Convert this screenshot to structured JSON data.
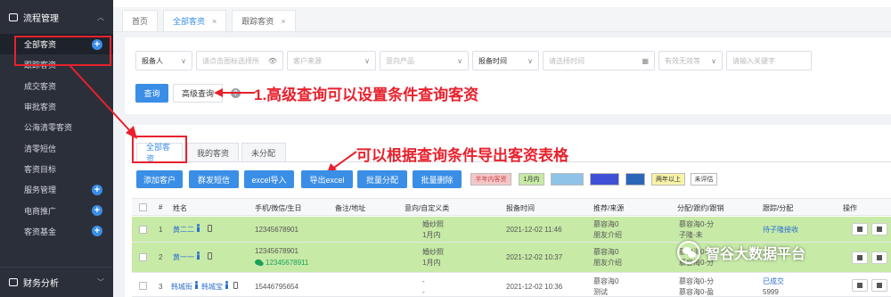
{
  "sidebar": {
    "group_title": "流程管理",
    "items": [
      {
        "label": "全部客资"
      },
      {
        "label": "跟踪客资"
      },
      {
        "label": "成交客资"
      },
      {
        "label": "审批客资"
      },
      {
        "label": "公海清零客资"
      },
      {
        "label": "清零短信"
      },
      {
        "label": "客资目标"
      },
      {
        "label": "服务管理"
      },
      {
        "label": "电商推广"
      },
      {
        "label": "客资基金"
      }
    ],
    "bottom_group": "财务分析"
  },
  "page_tabs": [
    {
      "label": "首页"
    },
    {
      "label": "全部客资",
      "close": "×"
    },
    {
      "label": "跟踪客资",
      "close": "×"
    }
  ],
  "filters": {
    "reporter": "报备人",
    "region_placeholder": "请点击图标选择所",
    "source_placeholder": "客户来源",
    "product_placeholder": "意向产品",
    "report_time": "报备时间",
    "date_placeholder": "请选择时间",
    "valid_placeholder": "有效无效等",
    "keyword_placeholder": "请输入关键字",
    "query_btn": "查询",
    "advanced_btn": "高级查询",
    "help": "?"
  },
  "annotations": {
    "a1": "1.高级查询可以设置条件查询客资",
    "a2": "可以根据查询条件导出客资表格"
  },
  "list_tabs": [
    {
      "label": "全部客资"
    },
    {
      "label": "我的客资"
    },
    {
      "label": "未分配"
    }
  ],
  "actions": [
    {
      "label": "添加客户"
    },
    {
      "label": "群发短信"
    },
    {
      "label": "excel导入"
    },
    {
      "label": "导出excel"
    },
    {
      "label": "批量分配"
    },
    {
      "label": "批量删除"
    }
  ],
  "legend": [
    {
      "label": "半年内客资",
      "color": "#f4c7c7",
      "text_color": "#c44"
    },
    {
      "label": "1月内",
      "color": "#c7eaa6",
      "text_color": "#333"
    },
    {
      "label": "",
      "color": "#8fc3e8",
      "text_color": "#333"
    },
    {
      "label": "",
      "color": "#3f4fd6",
      "text_color": "#fff"
    },
    {
      "label": "",
      "color": "#2b67b8",
      "text_color": "#fff"
    },
    {
      "label": "两年以上",
      "color": "#f8f3a8",
      "text_color": "#333"
    },
    {
      "label": "未评估",
      "color": "#ffffff",
      "text_color": "#333"
    }
  ],
  "table": {
    "headers": [
      "#",
      "姓名",
      "手机/微信/生日",
      "备注/地址",
      "意向/自定义类",
      "报备时间",
      "推荐/来源",
      "分配/跟约/跟销",
      "跟踪/分配",
      "操作"
    ],
    "rows": [
      {
        "index": "1",
        "name": "黄二二",
        "phone": "12345678901",
        "wechat": "",
        "note": "",
        "intent": "婚纱照",
        "intent2": "1月内",
        "time": "2021-12-02 11:46",
        "src1": "慕容海0",
        "src2": "朋友介绍",
        "assign1": "慕容海0-分",
        "assign2": "子隆-未",
        "track": "待子隆接收",
        "track2": ""
      },
      {
        "index": "2",
        "name": "黄一一",
        "phone": "12345678901",
        "wechat": "12345678911",
        "note": "",
        "intent": "婚纱照",
        "intent2": "1月内",
        "time": "2021-12-02 10:37",
        "src1": "慕容海0",
        "src2": "朋友介绍",
        "assign1": "慕容海0-分",
        "assign2": "慕容海0-分",
        "track": "",
        "track2": ""
      },
      {
        "index": "3",
        "name": "韩城街",
        "name2": "韩城宝",
        "phone": "15446795654",
        "wechat": "",
        "note": "",
        "intent": "-",
        "intent2": "-",
        "time": "2021-12-02 10:36",
        "src1": "慕容海0",
        "src2": "测试",
        "assign1": "慕容海0-分",
        "assign2": "慕容海0-盈",
        "track": "已成交",
        "track2": "5999"
      }
    ]
  },
  "watermark": "智谷大数据平台",
  "colors": {
    "accent": "#3a8ee6",
    "annotation": "#e8212d",
    "sidebar": "#2b2f3a",
    "row_green": "#c7eaa6"
  }
}
